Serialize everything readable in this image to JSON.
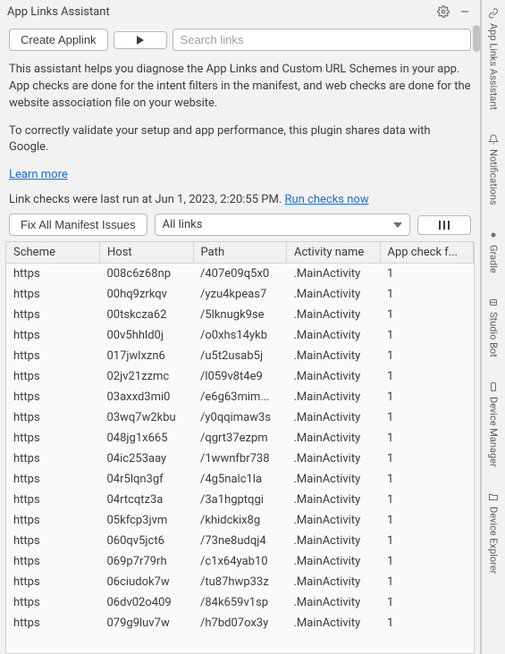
{
  "window": {
    "title": "App Links Assistant"
  },
  "toolbar": {
    "create_label": "Create Applink",
    "search_placeholder": "Search links"
  },
  "description": {
    "p1": "This assistant helps you diagnose the App Links and Custom URL Schemes in your app. App checks are done for the intent filters in the manifest, and web checks are done for the website association file on your website.",
    "p2": "To correctly validate your setup and app performance, this plugin shares data with Google.",
    "learn_more": "Learn more"
  },
  "status": {
    "last_run_prefix": "Link checks were last run at ",
    "last_run_time": "Jun 1, 2023, 2:20:55 PM",
    "run_now": "Run checks now"
  },
  "controls": {
    "fix_label": "Fix All Manifest Issues",
    "filter_label": "All links"
  },
  "table": {
    "headers": {
      "scheme": "Scheme",
      "host": "Host",
      "path": "Path",
      "activity": "Activity name",
      "check": "App check f..."
    },
    "rows": [
      {
        "scheme": "https",
        "host": "008c6z68np",
        "path": "/407e09q5x0",
        "activity": ".MainActivity",
        "check": "1"
      },
      {
        "scheme": "https",
        "host": "00hq9zrkqv",
        "path": "/yzu4kpeas7",
        "activity": ".MainActivity",
        "check": "1"
      },
      {
        "scheme": "https",
        "host": "00tskcza62",
        "path": "/5lknugk9se",
        "activity": ".MainActivity",
        "check": "1"
      },
      {
        "scheme": "https",
        "host": "00v5hhld0j",
        "path": "/o0xhs14ykb",
        "activity": ".MainActivity",
        "check": "1"
      },
      {
        "scheme": "https",
        "host": "017jwlxzn6",
        "path": "/u5t2usab5j",
        "activity": ".MainActivity",
        "check": "1"
      },
      {
        "scheme": "https",
        "host": "02jv21zzmc",
        "path": "/l059v8t4e9",
        "activity": ".MainActivity",
        "check": "1"
      },
      {
        "scheme": "https",
        "host": "03axxd3mi0",
        "path": "/e6g63mim...",
        "activity": ".MainActivity",
        "check": "1"
      },
      {
        "scheme": "https",
        "host": "03wq7w2kbu",
        "path": "/y0qqimaw3s",
        "activity": ".MainActivity",
        "check": "1"
      },
      {
        "scheme": "https",
        "host": "048jg1x665",
        "path": "/qgrt37ezpm",
        "activity": ".MainActivity",
        "check": "1"
      },
      {
        "scheme": "https",
        "host": "04ic253aay",
        "path": "/1wwnfbr738",
        "activity": ".MainActivity",
        "check": "1"
      },
      {
        "scheme": "https",
        "host": "04r5lqn3gf",
        "path": "/4g5nalc1la",
        "activity": ".MainActivity",
        "check": "1"
      },
      {
        "scheme": "https",
        "host": "04rtcqtz3a",
        "path": "/3a1hgptqgi",
        "activity": ".MainActivity",
        "check": "1"
      },
      {
        "scheme": "https",
        "host": "05kfcp3jvm",
        "path": "/khidckix8g",
        "activity": ".MainActivity",
        "check": "1"
      },
      {
        "scheme": "https",
        "host": "060qv5jct6",
        "path": "/73ne8udqj4",
        "activity": ".MainActivity",
        "check": "1"
      },
      {
        "scheme": "https",
        "host": "069p7r79rh",
        "path": "/c1x64yab10",
        "activity": ".MainActivity",
        "check": "1"
      },
      {
        "scheme": "https",
        "host": "06ciudok7w",
        "path": "/tu87hwp33z",
        "activity": ".MainActivity",
        "check": "1"
      },
      {
        "scheme": "https",
        "host": "06dv02o409",
        "path": "/84k659v1sp",
        "activity": ".MainActivity",
        "check": "1"
      },
      {
        "scheme": "https",
        "host": "079g9luv7w",
        "path": "/h7bd07ox3y",
        "activity": ".MainActivity",
        "check": "1"
      }
    ]
  },
  "rail": {
    "items": [
      {
        "label": "App Links Assistant",
        "icon": "link"
      },
      {
        "label": "Notifications",
        "icon": "bell"
      },
      {
        "label": "Gradle",
        "icon": "elephant"
      },
      {
        "label": "Studio Bot",
        "icon": "robot"
      },
      {
        "label": "Device Manager",
        "icon": "phone"
      },
      {
        "label": "Device Explorer",
        "icon": "folder"
      }
    ]
  }
}
